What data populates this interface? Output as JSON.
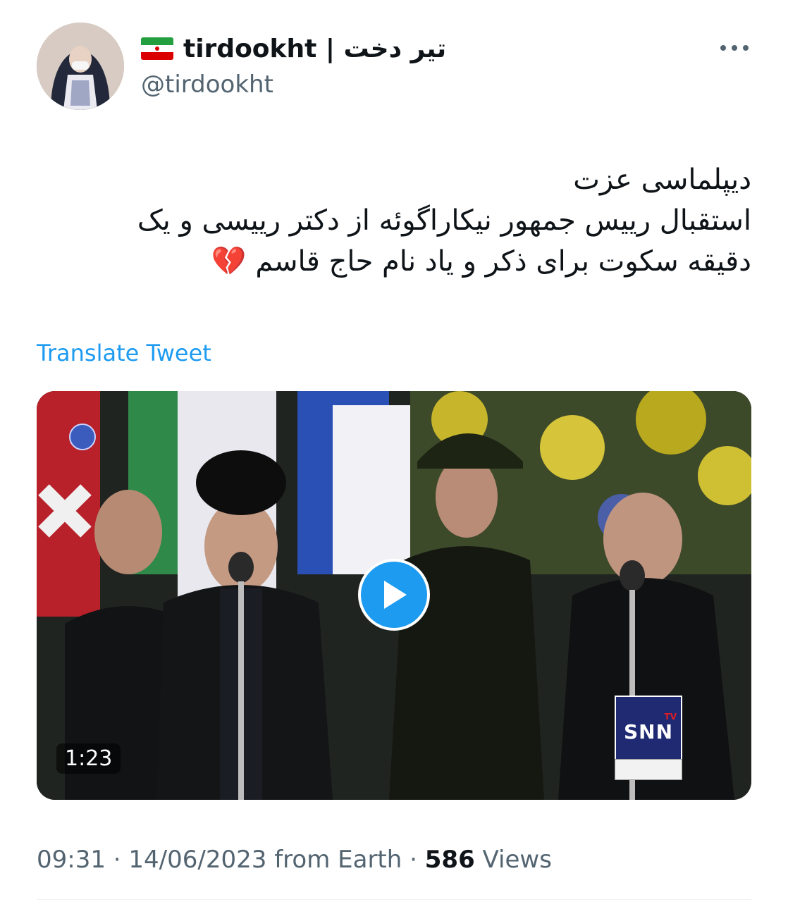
{
  "author": {
    "display_name": "tirdookht | تیر دخت",
    "handle": "@tirdookht",
    "flag": "iran-flag-icon"
  },
  "tweet": {
    "lines": [
      "دیپلماسی عزت",
      "استقبال رییس جمهور نیکاراگوئه از دکتر رییسی و یک",
      "دقیقه سکوت برای ذکر و یاد نام حاج قاسم 💔"
    ],
    "translate_label": "Translate Tweet"
  },
  "media": {
    "duration": "1:23",
    "watermark": "SNN",
    "watermark_tv": "TV"
  },
  "meta": {
    "time": "09:31",
    "date": "14/06/2023",
    "source": "from Earth",
    "separator": "·",
    "views_count": "586",
    "views_label": "Views"
  },
  "colors": {
    "accent": "#1d9bf0",
    "text": "#0f1419",
    "secondary": "#536471"
  }
}
